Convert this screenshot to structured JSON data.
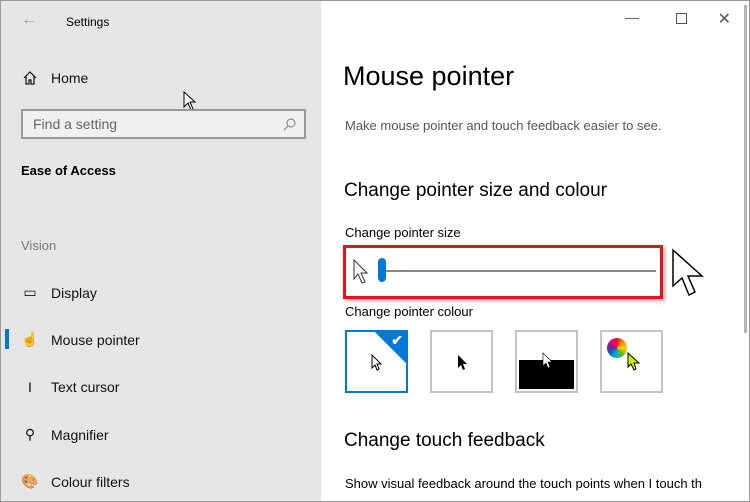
{
  "window": {
    "title": "Settings"
  },
  "sidebar": {
    "home": "Home",
    "search_placeholder": "Find a setting",
    "section": "Ease of Access",
    "group": "Vision",
    "items": [
      {
        "label": "Display"
      },
      {
        "label": "Mouse pointer"
      },
      {
        "label": "Text cursor"
      },
      {
        "label": "Magnifier"
      },
      {
        "label": "Colour filters"
      }
    ]
  },
  "main": {
    "title": "Mouse pointer",
    "subtitle": "Make mouse pointer and touch feedback easier to see.",
    "heading1": "Change pointer size and colour",
    "size_label": "Change pointer size",
    "size_value": 1,
    "size_min": 1,
    "size_max": 15,
    "colour_label": "Change pointer colour",
    "colour_options": [
      "white",
      "black",
      "inverted",
      "custom"
    ],
    "selected_colour": "white",
    "heading2": "Change touch feedback",
    "touch_text": "Show visual feedback around the touch points when I touch th"
  },
  "colors": {
    "accent": "#0078d7",
    "highlight": "#e81123"
  }
}
